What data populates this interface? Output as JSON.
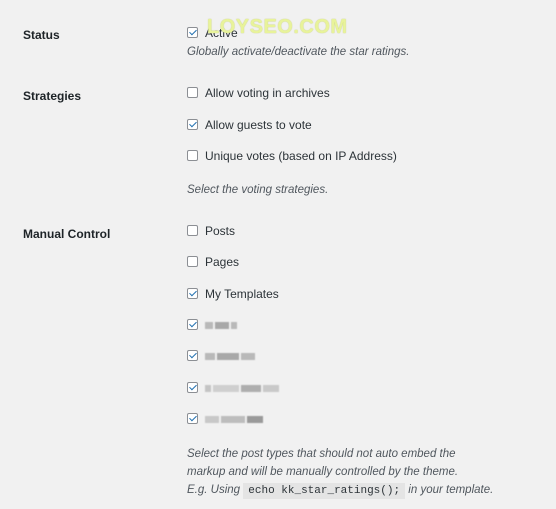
{
  "status": {
    "label": "Status",
    "option": {
      "label": "Active",
      "checked": true
    },
    "description": "Globally activate/deactivate the star ratings."
  },
  "strategies": {
    "label": "Strategies",
    "options": [
      {
        "label": "Allow voting in archives",
        "checked": false
      },
      {
        "label": "Allow guests to vote",
        "checked": true
      },
      {
        "label": "Unique votes (based on IP Address)",
        "checked": false
      }
    ],
    "description": "Select the voting strategies."
  },
  "manual_control": {
    "label": "Manual Control",
    "options": [
      {
        "label": "Posts",
        "checked": false
      },
      {
        "label": "Pages",
        "checked": false
      },
      {
        "label": "My Templates",
        "checked": true
      },
      {
        "label": "",
        "checked": true
      },
      {
        "label": "",
        "checked": true
      },
      {
        "label": "",
        "checked": true
      },
      {
        "label": "",
        "checked": true
      }
    ],
    "description_line1": "Select the post types that should not auto embed the",
    "description_line2": "markup and will be manually controlled by the theme.",
    "description_line3_prefix": "E.g. Using",
    "description_code": "echo kk_star_ratings();",
    "description_line3_suffix": "in your template."
  },
  "watermark": "LOYSEO.COM"
}
